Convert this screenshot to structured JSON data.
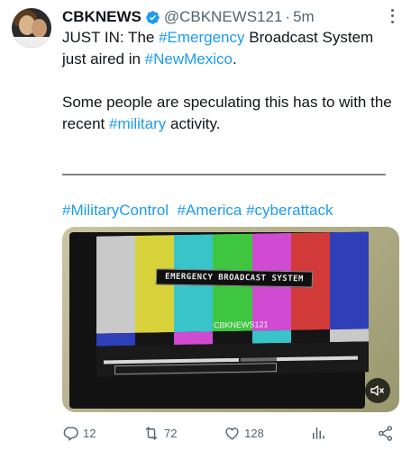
{
  "author": {
    "name": "CBKNEWS",
    "handle": "@CBKNEWS121",
    "separator": "·",
    "time": "5m"
  },
  "tweet": {
    "p1_a": "JUST IN: The ",
    "p1_tag1": "#Emergency",
    "p1_b": " Broadcast System just aired in ",
    "p1_tag2": "#NewMexico",
    "p1_c": ".",
    "p2_a": "Some people are speculating this has to with the recent ",
    "p2_tag": "#military",
    "p2_b": " activity.",
    "separator_line": "________________________________________",
    "hashtags": [
      "#MilitaryControl",
      "#America",
      "#cyberattack"
    ]
  },
  "media": {
    "screen_text": "EMERGENCY BROADCAST SYSTEM",
    "watermark": "CBKNEWS121",
    "mute_icon": "speaker-muted-icon"
  },
  "actions": {
    "replies": "12",
    "reposts": "72",
    "likes": "128"
  },
  "colors": {
    "accent": "#1d9bf0",
    "muted": "#536471",
    "text": "#0f1419"
  }
}
